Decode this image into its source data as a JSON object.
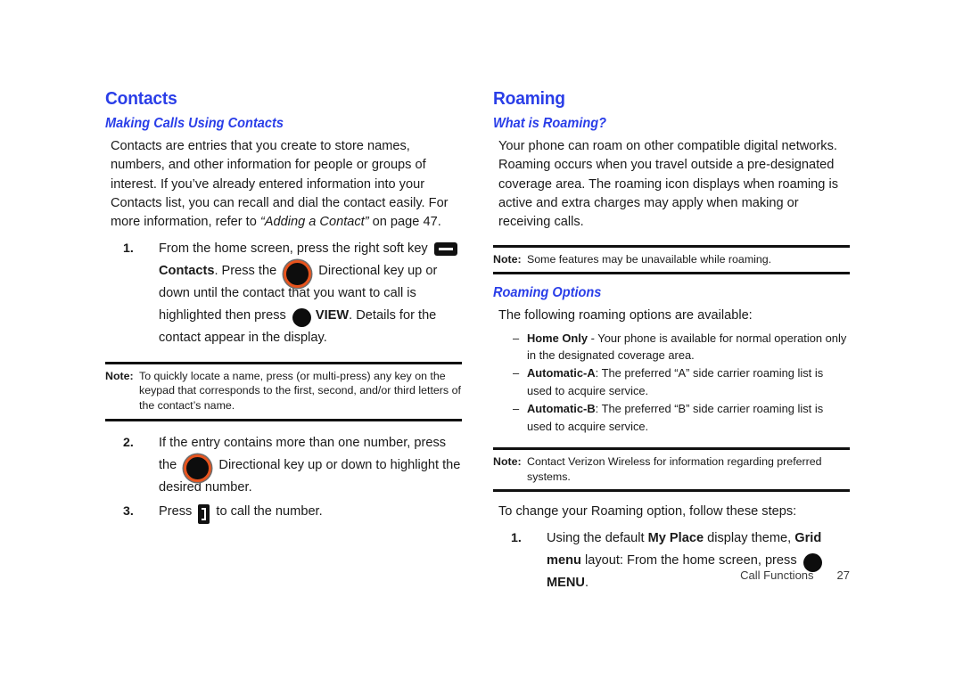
{
  "colors": {
    "heading_blue": "#2a3ee8",
    "body_text": "#1a1a1a",
    "dpad_ring": "#e8541e",
    "rule": "#111111"
  },
  "left": {
    "heading": "Contacts",
    "subheading": "Making Calls Using Contacts",
    "intro_1": "Contacts are entries that you create to store names, numbers, and other information for people or groups of interest. If you’ve already entered information into your Contacts list, you can recall and dial the contact easily. For more information, refer to ",
    "intro_italic": "“Adding a Contact”",
    "intro_2": " on page 47.",
    "steps": [
      {
        "num": "1.",
        "t1": "From the home screen, press the right soft key ",
        "icon1": "soft-key-icon",
        "t2": "",
        "b1": "Contacts",
        "t3": ". Press the ",
        "icon2": "directional-key-icon",
        "t4": " Directional key up or down until the contact that you want to call is highlighted then press ",
        "icon3": "select-key-icon",
        "b2": "VIEW",
        "t5": ". Details for the contact appear in the display."
      },
      {
        "num": "2.",
        "t1": "If the entry contains more than one number, press the ",
        "icon1": "directional-key-icon",
        "t2": " Directional key up or down to highlight the desired number."
      },
      {
        "num": "3.",
        "t1": "Press ",
        "icon1": "send-key-icon",
        "t2": " to call the number."
      }
    ],
    "note": {
      "label": "Note:",
      "text": "To quickly locate a name, press (or multi-press) any key on the keypad that corresponds to the first, second, and/or third letters of the contact’s name."
    }
  },
  "right": {
    "heading": "Roaming",
    "subheading_1": "What is Roaming?",
    "intro": "Your phone can roam on other compatible digital networks. Roaming occurs when you travel outside a pre-designated coverage area. The roaming icon displays when roaming is active and extra charges may apply when making or receiving calls.",
    "note_1": {
      "label": "Note:",
      "text": "Some features may be unavailable while roaming."
    },
    "subheading_2": "Roaming Options",
    "options_lead": "The following roaming options are available:",
    "options": [
      {
        "dash": "–",
        "term": "Home Only",
        "desc": " - Your phone is available for normal operation only in the designated coverage area."
      },
      {
        "dash": "–",
        "term": "Automatic-A",
        "desc": ": The preferred “A” side carrier roaming list is used to acquire service."
      },
      {
        "dash": "–",
        "term": "Automatic-B",
        "desc": ": The preferred “B” side carrier roaming list is used to acquire service."
      }
    ],
    "note_2": {
      "label": "Note:",
      "text": "Contact Verizon Wireless for information regarding preferred systems."
    },
    "change_lead": "To change your Roaming option, follow these steps:",
    "step_1": {
      "num": "1.",
      "t1": "Using the default ",
      "b1": "My Place",
      "t2": " display theme, ",
      "b2": "Grid menu",
      "t3": " layout: From the home screen, press ",
      "icon1": "select-key-icon",
      "b3": "MENU",
      "t4": "."
    }
  },
  "footer": {
    "section": "Call Functions",
    "page_number": "27"
  }
}
